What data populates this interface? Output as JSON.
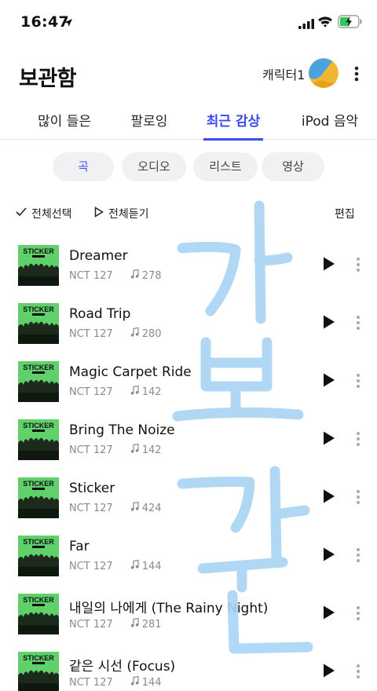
{
  "status_bar": {
    "time": "16:47",
    "icons": [
      "location-arrow-icon",
      "cellular-signal-icon",
      "wifi-icon",
      "battery-charging-icon"
    ]
  },
  "header": {
    "title": "보관함",
    "character_name": "캐릭터1",
    "avatar_icon": "character-avatar",
    "more_icon": "more-vert-icon"
  },
  "tabs": [
    {
      "label": "많이 들은",
      "active": false
    },
    {
      "label": "팔로잉",
      "active": false
    },
    {
      "label": "최근 감상",
      "active": true
    },
    {
      "label": "iPod 음악",
      "active": false
    }
  ],
  "filters": [
    {
      "label": "곡",
      "active": true
    },
    {
      "label": "오디오",
      "active": false
    },
    {
      "label": "리스트",
      "active": false
    },
    {
      "label": "영상",
      "active": false
    }
  ],
  "actions": {
    "select_all": "전체선택",
    "play_all": "전체듣기",
    "edit": "편집"
  },
  "songs": [
    {
      "title": "Dreamer",
      "artist": "NCT 127",
      "plays": "278"
    },
    {
      "title": "Road Trip",
      "artist": "NCT 127",
      "plays": "280"
    },
    {
      "title": "Magic Carpet Ride",
      "artist": "NCT 127",
      "plays": "142"
    },
    {
      "title": "Bring The Noize",
      "artist": "NCT 127",
      "plays": "142"
    },
    {
      "title": "Sticker",
      "artist": "NCT 127",
      "plays": "424"
    },
    {
      "title": "Far",
      "artist": "NCT 127",
      "plays": "144"
    },
    {
      "title": "내일의 나에게 (The Rainy Night)",
      "artist": "NCT 127",
      "plays": "281"
    },
    {
      "title": "같은 시선 (Focus)",
      "artist": "NCT 127",
      "plays": "144"
    }
  ],
  "album_art_text": "STICKER",
  "overlay": {
    "kind": "handwritten-doodle",
    "color": "#a8d4f5"
  },
  "colors": {
    "accent": "#3a4bf0",
    "chip_bg": "#f1f1f3",
    "meta": "#8a8a8a",
    "album_green": "#5fd06a"
  }
}
